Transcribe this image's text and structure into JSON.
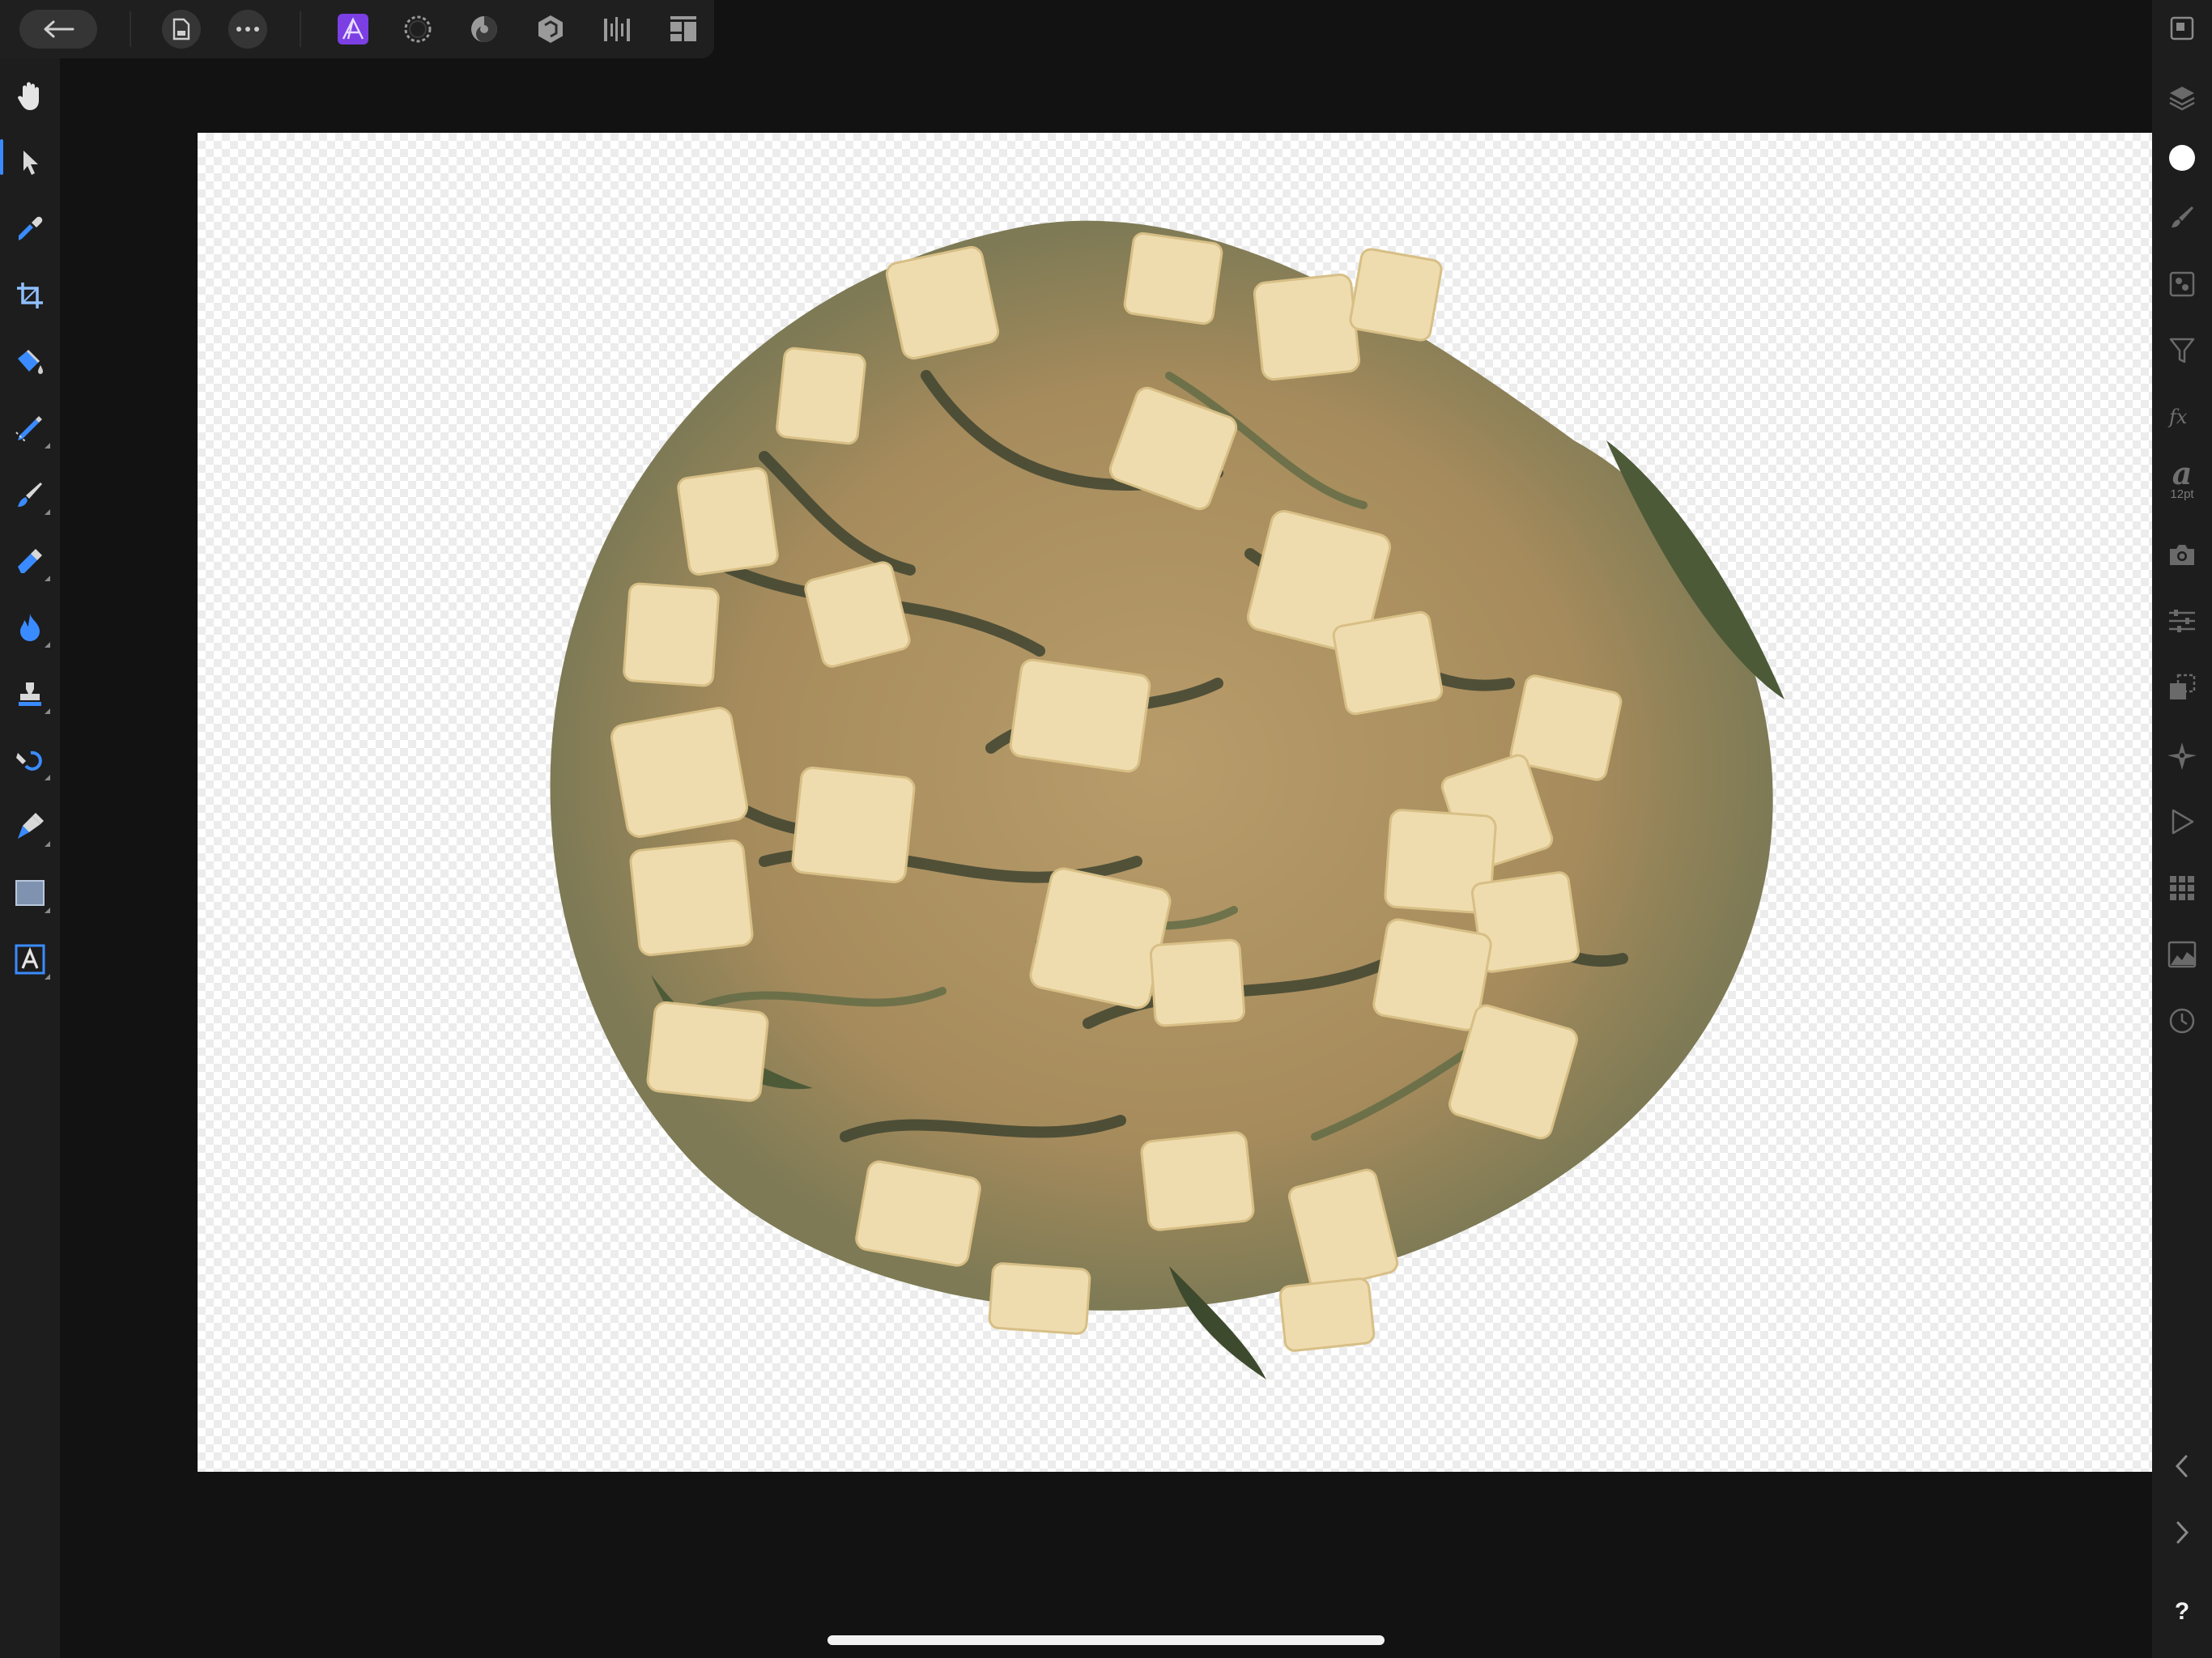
{
  "top_toolbar": {
    "back": {
      "icon": "arrow-left-icon"
    },
    "document": {
      "icon": "document-icon"
    },
    "more": {
      "icon": "more-dots-icon"
    },
    "personas": [
      {
        "name": "photo-persona",
        "icon": "photo-persona-icon",
        "active": true,
        "color": "#7b3fe4"
      },
      {
        "name": "liquify-persona",
        "icon": "liquify-persona-icon",
        "active": false
      },
      {
        "name": "develop-persona",
        "icon": "develop-persona-icon",
        "active": false
      },
      {
        "name": "tone-mapping-persona",
        "icon": "tone-mapping-persona-icon",
        "active": false
      },
      {
        "name": "export-persona",
        "icon": "export-persona-icon",
        "active": false
      },
      {
        "name": "more-personas",
        "icon": "personas-grid-icon",
        "active": false
      }
    ]
  },
  "left_tools": [
    {
      "name": "view-tool",
      "icon": "hand-icon",
      "active": true
    },
    {
      "name": "move-tool",
      "icon": "pointer-arrow-icon"
    },
    {
      "name": "color-picker-tool",
      "icon": "eyedropper-icon"
    },
    {
      "name": "crop-tool",
      "icon": "crop-icon"
    },
    {
      "name": "flood-fill-tool",
      "icon": "paint-bucket-icon"
    },
    {
      "name": "selection-brush-tool",
      "icon": "selection-brush-icon"
    },
    {
      "name": "paint-brush-tool",
      "icon": "paint-brush-icon"
    },
    {
      "name": "erase-brush-tool",
      "icon": "eraser-icon"
    },
    {
      "name": "burn-tool",
      "icon": "flame-icon"
    },
    {
      "name": "clone-tool",
      "icon": "clone-stamp-icon"
    },
    {
      "name": "healing-tool",
      "icon": "healing-brush-icon"
    },
    {
      "name": "pen-tool",
      "icon": "pen-nib-icon"
    },
    {
      "name": "rectangle-tool",
      "icon": "rectangle-icon"
    },
    {
      "name": "artistic-text-tool",
      "icon": "text-frame-icon"
    }
  ],
  "right_studio": {
    "font_size_label": "12pt",
    "help_label": "?",
    "items": [
      {
        "name": "navigator-studio",
        "icon": "navigator-icon"
      },
      {
        "name": "layers-studio",
        "icon": "layers-icon"
      },
      {
        "name": "color-studio",
        "icon": "color-circle-icon"
      },
      {
        "name": "brushes-studio",
        "icon": "brush-icon"
      },
      {
        "name": "channels-studio",
        "icon": "channels-icon"
      },
      {
        "name": "adjustments-studio",
        "icon": "funnel-icon"
      },
      {
        "name": "fx-studio",
        "icon": "fx-icon"
      },
      {
        "name": "text-studio",
        "icon": "text-style-icon"
      },
      {
        "name": "stock-studio",
        "icon": "camera-icon"
      },
      {
        "name": "sliders-studio",
        "icon": "sliders-icon"
      },
      {
        "name": "transform-studio",
        "icon": "transform-icon"
      },
      {
        "name": "navigate-studio",
        "icon": "compass-icon"
      },
      {
        "name": "macro-studio",
        "icon": "play-icon"
      },
      {
        "name": "swatches-studio",
        "icon": "swatches-grid-icon"
      },
      {
        "name": "histogram-studio",
        "icon": "histogram-icon"
      },
      {
        "name": "history-studio",
        "icon": "clock-icon"
      }
    ],
    "nav": [
      {
        "name": "collapse-left",
        "icon": "chevron-left-icon"
      },
      {
        "name": "collapse-right",
        "icon": "chevron-right-icon"
      }
    ]
  },
  "colors": {
    "accent": "#7b3fe4",
    "active_tool": "#3a8bff",
    "primary_color_swatch": "#ffffff"
  }
}
